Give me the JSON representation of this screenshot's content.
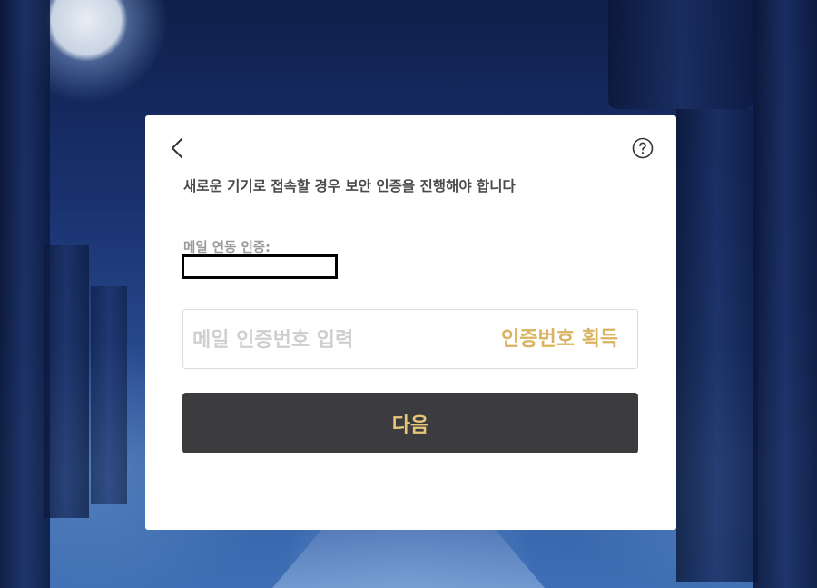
{
  "dialog": {
    "subtitle": "새로운 기기로 접속할 경우 보안 인증을 진행해야 합니다",
    "email_label": "메일 연동 인증:",
    "email_value": "",
    "code_placeholder": "메일 인증번호 입력",
    "code_value": "",
    "get_code_label": "인증번호 획득",
    "next_label": "다음",
    "back_icon": "chevron-left-icon",
    "help_icon": "question-circle-icon"
  },
  "colors": {
    "accent_gold": "#d9b35f",
    "button_dark": "#3c3c3e",
    "button_text": "#e8c679"
  }
}
